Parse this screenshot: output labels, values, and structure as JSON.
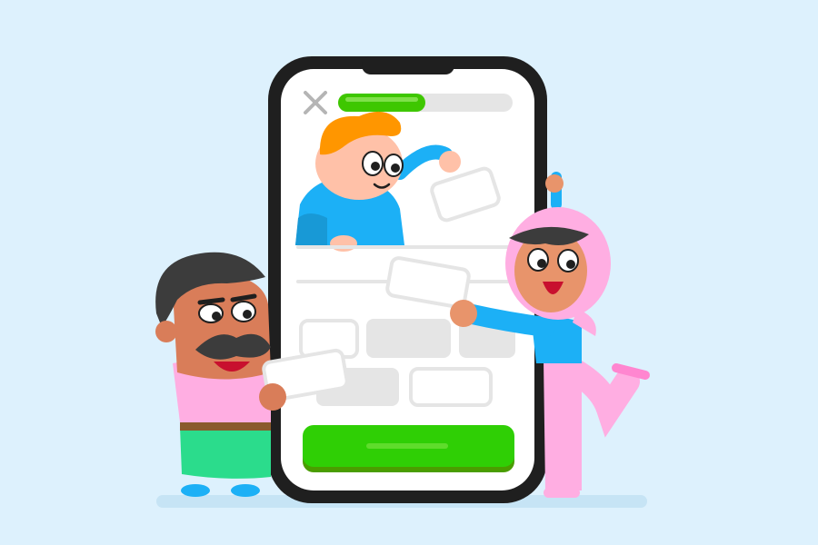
{
  "colors": {
    "background": "#ddf1fd",
    "phone_frame": "#1f1f1f",
    "screen": "#ffffff",
    "progress_fill": "#3ec700",
    "progress_track": "#e5e5e5",
    "button": "#2fcf05",
    "button_shadow": "#4a9d00",
    "tile_gray": "#e5e5e5"
  },
  "progress": {
    "fraction": 0.5
  },
  "icons": {
    "close": "close-icon"
  }
}
